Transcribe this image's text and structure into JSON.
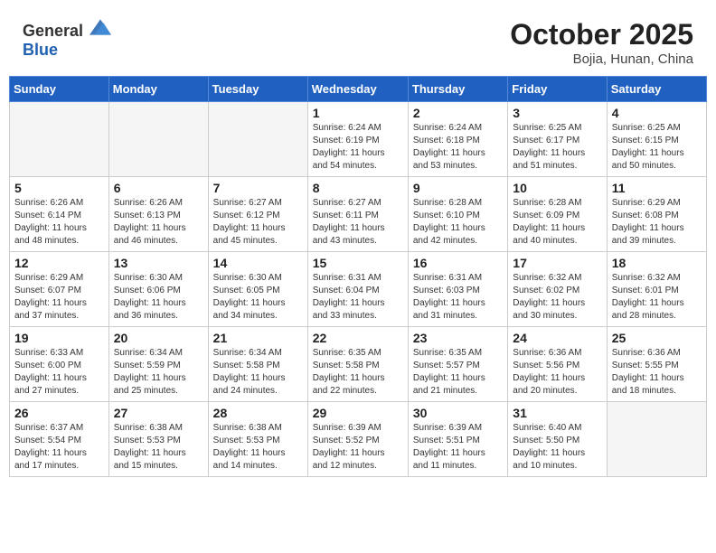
{
  "header": {
    "logo_general": "General",
    "logo_blue": "Blue",
    "month": "October 2025",
    "location": "Bojia, Hunan, China"
  },
  "weekdays": [
    "Sunday",
    "Monday",
    "Tuesday",
    "Wednesday",
    "Thursday",
    "Friday",
    "Saturday"
  ],
  "weeks": [
    [
      {
        "day": "",
        "info": ""
      },
      {
        "day": "",
        "info": ""
      },
      {
        "day": "",
        "info": ""
      },
      {
        "day": "1",
        "info": "Sunrise: 6:24 AM\nSunset: 6:19 PM\nDaylight: 11 hours\nand 54 minutes."
      },
      {
        "day": "2",
        "info": "Sunrise: 6:24 AM\nSunset: 6:18 PM\nDaylight: 11 hours\nand 53 minutes."
      },
      {
        "day": "3",
        "info": "Sunrise: 6:25 AM\nSunset: 6:17 PM\nDaylight: 11 hours\nand 51 minutes."
      },
      {
        "day": "4",
        "info": "Sunrise: 6:25 AM\nSunset: 6:15 PM\nDaylight: 11 hours\nand 50 minutes."
      }
    ],
    [
      {
        "day": "5",
        "info": "Sunrise: 6:26 AM\nSunset: 6:14 PM\nDaylight: 11 hours\nand 48 minutes."
      },
      {
        "day": "6",
        "info": "Sunrise: 6:26 AM\nSunset: 6:13 PM\nDaylight: 11 hours\nand 46 minutes."
      },
      {
        "day": "7",
        "info": "Sunrise: 6:27 AM\nSunset: 6:12 PM\nDaylight: 11 hours\nand 45 minutes."
      },
      {
        "day": "8",
        "info": "Sunrise: 6:27 AM\nSunset: 6:11 PM\nDaylight: 11 hours\nand 43 minutes."
      },
      {
        "day": "9",
        "info": "Sunrise: 6:28 AM\nSunset: 6:10 PM\nDaylight: 11 hours\nand 42 minutes."
      },
      {
        "day": "10",
        "info": "Sunrise: 6:28 AM\nSunset: 6:09 PM\nDaylight: 11 hours\nand 40 minutes."
      },
      {
        "day": "11",
        "info": "Sunrise: 6:29 AM\nSunset: 6:08 PM\nDaylight: 11 hours\nand 39 minutes."
      }
    ],
    [
      {
        "day": "12",
        "info": "Sunrise: 6:29 AM\nSunset: 6:07 PM\nDaylight: 11 hours\nand 37 minutes."
      },
      {
        "day": "13",
        "info": "Sunrise: 6:30 AM\nSunset: 6:06 PM\nDaylight: 11 hours\nand 36 minutes."
      },
      {
        "day": "14",
        "info": "Sunrise: 6:30 AM\nSunset: 6:05 PM\nDaylight: 11 hours\nand 34 minutes."
      },
      {
        "day": "15",
        "info": "Sunrise: 6:31 AM\nSunset: 6:04 PM\nDaylight: 11 hours\nand 33 minutes."
      },
      {
        "day": "16",
        "info": "Sunrise: 6:31 AM\nSunset: 6:03 PM\nDaylight: 11 hours\nand 31 minutes."
      },
      {
        "day": "17",
        "info": "Sunrise: 6:32 AM\nSunset: 6:02 PM\nDaylight: 11 hours\nand 30 minutes."
      },
      {
        "day": "18",
        "info": "Sunrise: 6:32 AM\nSunset: 6:01 PM\nDaylight: 11 hours\nand 28 minutes."
      }
    ],
    [
      {
        "day": "19",
        "info": "Sunrise: 6:33 AM\nSunset: 6:00 PM\nDaylight: 11 hours\nand 27 minutes."
      },
      {
        "day": "20",
        "info": "Sunrise: 6:34 AM\nSunset: 5:59 PM\nDaylight: 11 hours\nand 25 minutes."
      },
      {
        "day": "21",
        "info": "Sunrise: 6:34 AM\nSunset: 5:58 PM\nDaylight: 11 hours\nand 24 minutes."
      },
      {
        "day": "22",
        "info": "Sunrise: 6:35 AM\nSunset: 5:58 PM\nDaylight: 11 hours\nand 22 minutes."
      },
      {
        "day": "23",
        "info": "Sunrise: 6:35 AM\nSunset: 5:57 PM\nDaylight: 11 hours\nand 21 minutes."
      },
      {
        "day": "24",
        "info": "Sunrise: 6:36 AM\nSunset: 5:56 PM\nDaylight: 11 hours\nand 20 minutes."
      },
      {
        "day": "25",
        "info": "Sunrise: 6:36 AM\nSunset: 5:55 PM\nDaylight: 11 hours\nand 18 minutes."
      }
    ],
    [
      {
        "day": "26",
        "info": "Sunrise: 6:37 AM\nSunset: 5:54 PM\nDaylight: 11 hours\nand 17 minutes."
      },
      {
        "day": "27",
        "info": "Sunrise: 6:38 AM\nSunset: 5:53 PM\nDaylight: 11 hours\nand 15 minutes."
      },
      {
        "day": "28",
        "info": "Sunrise: 6:38 AM\nSunset: 5:53 PM\nDaylight: 11 hours\nand 14 minutes."
      },
      {
        "day": "29",
        "info": "Sunrise: 6:39 AM\nSunset: 5:52 PM\nDaylight: 11 hours\nand 12 minutes."
      },
      {
        "day": "30",
        "info": "Sunrise: 6:39 AM\nSunset: 5:51 PM\nDaylight: 11 hours\nand 11 minutes."
      },
      {
        "day": "31",
        "info": "Sunrise: 6:40 AM\nSunset: 5:50 PM\nDaylight: 11 hours\nand 10 minutes."
      },
      {
        "day": "",
        "info": ""
      }
    ]
  ]
}
